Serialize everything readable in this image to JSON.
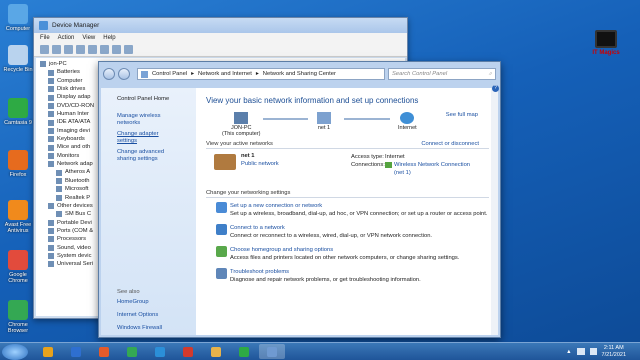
{
  "desktop": {
    "icons": [
      {
        "label": "Computer",
        "color": "#5aa7e6"
      },
      {
        "label": "Recycle Bin",
        "color": "#b9d3ee"
      },
      {
        "label": "Camtasia 9",
        "color": "#2eaa44"
      },
      {
        "label": "Firefox",
        "color": "#e66b1e"
      },
      {
        "label": "Avast Free Antivirus",
        "color": "#f08a1c"
      },
      {
        "label": "Google Chrome",
        "color": "#e24b3c"
      },
      {
        "label": "Chrome Browser",
        "color": "#34a853"
      }
    ],
    "watermark": "IT Magics"
  },
  "device_manager": {
    "title": "Device Manager",
    "menu": [
      "File",
      "Action",
      "View",
      "Help"
    ],
    "tree": [
      {
        "label": "jon-PC",
        "indent": 0
      },
      {
        "label": "Batteries",
        "indent": 1
      },
      {
        "label": "Computer",
        "indent": 1
      },
      {
        "label": "Disk drives",
        "indent": 1
      },
      {
        "label": "Display adap",
        "indent": 1
      },
      {
        "label": "DVD/CD-RON",
        "indent": 1
      },
      {
        "label": "Human Inter",
        "indent": 1
      },
      {
        "label": "IDE ATA/ATA",
        "indent": 1
      },
      {
        "label": "Imaging devi",
        "indent": 1
      },
      {
        "label": "Keyboards",
        "indent": 1
      },
      {
        "label": "Mice and oth",
        "indent": 1
      },
      {
        "label": "Monitors",
        "indent": 1
      },
      {
        "label": "Network adap",
        "indent": 1
      },
      {
        "label": "Atheros A",
        "indent": 2
      },
      {
        "label": "Bluetooth",
        "indent": 2
      },
      {
        "label": "Microsoft",
        "indent": 2
      },
      {
        "label": "Realtek P",
        "indent": 2
      },
      {
        "label": "Other devices",
        "indent": 1
      },
      {
        "label": "SM Bus C",
        "indent": 2
      },
      {
        "label": "Portable Devi",
        "indent": 1
      },
      {
        "label": "Ports (COM &",
        "indent": 1
      },
      {
        "label": "Processors",
        "indent": 1
      },
      {
        "label": "Sound, video",
        "indent": 1
      },
      {
        "label": "System devic",
        "indent": 1
      },
      {
        "label": "Universal Seri",
        "indent": 1
      }
    ]
  },
  "network_center": {
    "address": [
      "Control Panel",
      "Network and Internet",
      "Network and Sharing Center"
    ],
    "search_placeholder": "Search Control Panel",
    "left": {
      "home": "Control Panel Home",
      "links": [
        "Manage wireless networks",
        "Change adapter settings",
        "Change advanced sharing settings"
      ],
      "see_also_title": "See also",
      "see_also": [
        "HomeGroup",
        "Internet Options",
        "Windows Firewall"
      ]
    },
    "heading": "View your basic network information and set up connections",
    "see_full_map": "See full map",
    "map_nodes": [
      {
        "label": "JON-PC",
        "sub": "(This computer)"
      },
      {
        "label": "net 1",
        "sub": ""
      },
      {
        "label": "Internet",
        "sub": ""
      }
    ],
    "active_section": "View your active networks",
    "connect_disconnect": "Connect or disconnect",
    "active_network": {
      "name": "net 1",
      "type": "Public network",
      "access_type_label": "Access type:",
      "access_type": "Internet",
      "connections_label": "Connections:",
      "connection": "Wireless Network Connection",
      "connection_sub": "(net 1)"
    },
    "change_section": "Change your networking settings",
    "tasks": [
      {
        "title": "Set up a new connection or network",
        "desc": "Set up a wireless, broadband, dial-up, ad hoc, or VPN connection; or set up a router or access point.",
        "color": "#4a8bd6"
      },
      {
        "title": "Connect to a network",
        "desc": "Connect or reconnect to a wireless, wired, dial-up, or VPN network connection.",
        "color": "#3f7fc8"
      },
      {
        "title": "Choose homegroup and sharing options",
        "desc": "Access files and printers located on other network computers, or change sharing settings.",
        "color": "#59a84b"
      },
      {
        "title": "Troubleshoot problems",
        "desc": "Diagnose and repair network problems, or get troubleshooting information.",
        "color": "#5f86b8"
      }
    ]
  },
  "taskbar": {
    "apps": [
      "#e8a21c",
      "#2e6fd0",
      "#e55b2b",
      "#34a853",
      "#2b8fd8",
      "#d33a2c",
      "#e8b34a",
      "#2eaa44",
      "#6f9ad1"
    ],
    "time": "2:11 AM",
    "date": "7/21/2021"
  }
}
